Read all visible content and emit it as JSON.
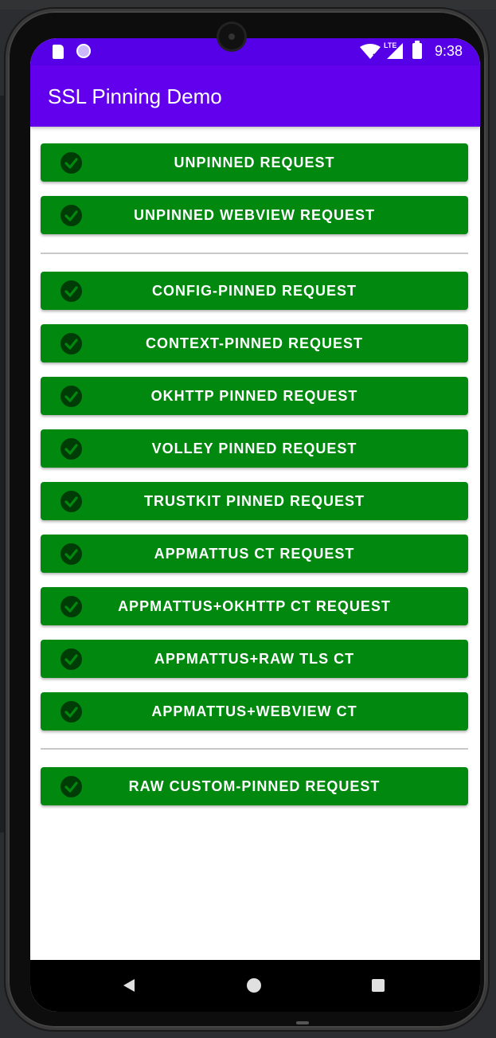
{
  "status_bar": {
    "time": "9:38",
    "network": "LTE",
    "icons": [
      "sd-card-icon",
      "notification-circle-icon",
      "wifi-icon",
      "signal-icon",
      "battery-icon"
    ]
  },
  "app_bar": {
    "title": "SSL Pinning Demo",
    "color": "#6200ee"
  },
  "button_color": "#00880f",
  "groups": [
    {
      "buttons": [
        {
          "label": "UNPINNED REQUEST",
          "icon": "check-circle-icon"
        },
        {
          "label": "UNPINNED WEBVIEW REQUEST",
          "icon": "check-circle-icon"
        }
      ]
    },
    {
      "buttons": [
        {
          "label": "CONFIG-PINNED REQUEST",
          "icon": "check-circle-icon"
        },
        {
          "label": "CONTEXT-PINNED REQUEST",
          "icon": "check-circle-icon"
        },
        {
          "label": "OKHTTP PINNED REQUEST",
          "icon": "check-circle-icon"
        },
        {
          "label": "VOLLEY PINNED REQUEST",
          "icon": "check-circle-icon"
        },
        {
          "label": "TRUSTKIT PINNED REQUEST",
          "icon": "check-circle-icon"
        },
        {
          "label": "APPMATTUS CT REQUEST",
          "icon": "check-circle-icon"
        },
        {
          "label": "APPMATTUS+OKHTTP CT REQUEST",
          "icon": "check-circle-icon"
        },
        {
          "label": "APPMATTUS+RAW TLS CT",
          "icon": "check-circle-icon"
        },
        {
          "label": "APPMATTUS+WEBVIEW CT",
          "icon": "check-circle-icon"
        }
      ]
    },
    {
      "buttons": [
        {
          "label": "RAW CUSTOM-PINNED REQUEST",
          "icon": "check-circle-icon"
        }
      ]
    }
  ],
  "nav_bar": {
    "icons": [
      "back-icon",
      "home-icon",
      "recents-icon"
    ]
  }
}
